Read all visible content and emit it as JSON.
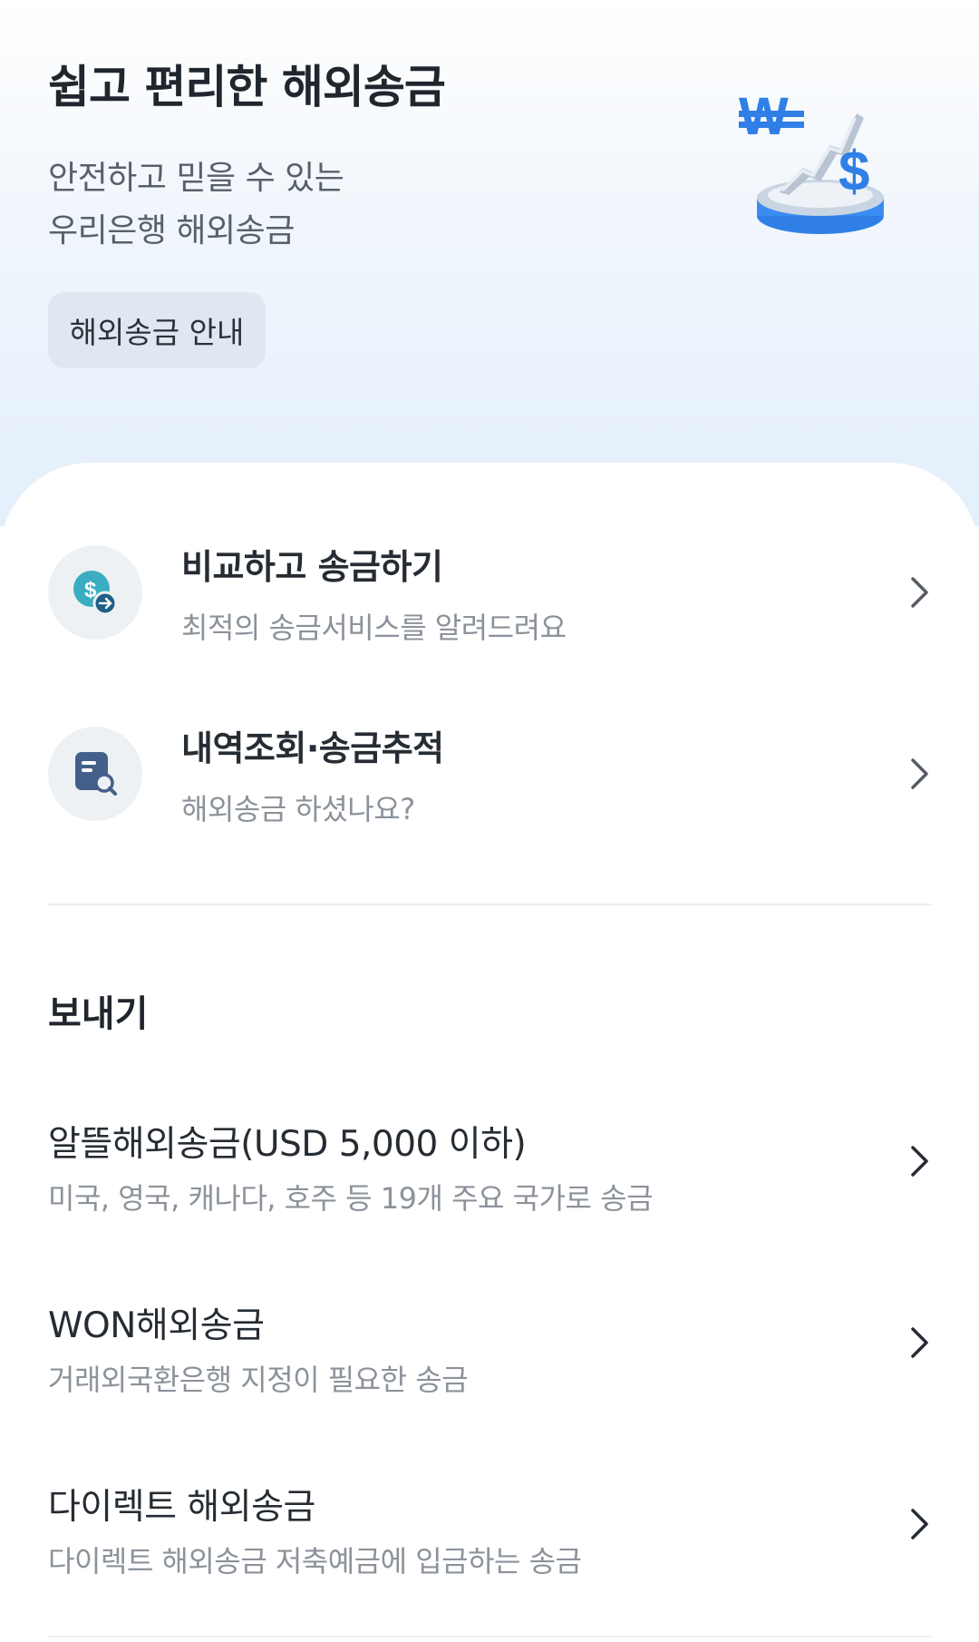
{
  "hero": {
    "title": "쉽고 편리한 해외송금",
    "subtitle_line1": "안전하고 믿을 수 있는",
    "subtitle_line2": "우리은행 해외송금",
    "guide_button": "해외송금 안내"
  },
  "services": [
    {
      "title": "비교하고 송금하기",
      "desc": "최적의 송금서비스를 알려드려요",
      "icon": "dollar-transfer-icon"
    },
    {
      "title": "내역조회·송금추적",
      "desc": "해외송금 하셨나요?",
      "icon": "document-search-icon"
    }
  ],
  "send_section": {
    "title": "보내기",
    "items": [
      {
        "title": "알뜰해외송금(USD 5,000 이하)",
        "desc": "미국, 영국, 캐나다, 호주 등 19개 주요 국가로 송금"
      },
      {
        "title": "WON해외송금",
        "desc": "거래외국환은행 지정이 필요한 송금"
      },
      {
        "title": "다이렉트 해외송금",
        "desc": "다이렉트 해외송금 저축예금에 입금하는 송금"
      }
    ]
  },
  "colors": {
    "accent_teal": "#3aaec0",
    "accent_blue": "#2f7fe6",
    "icon_navy": "#44608a"
  }
}
